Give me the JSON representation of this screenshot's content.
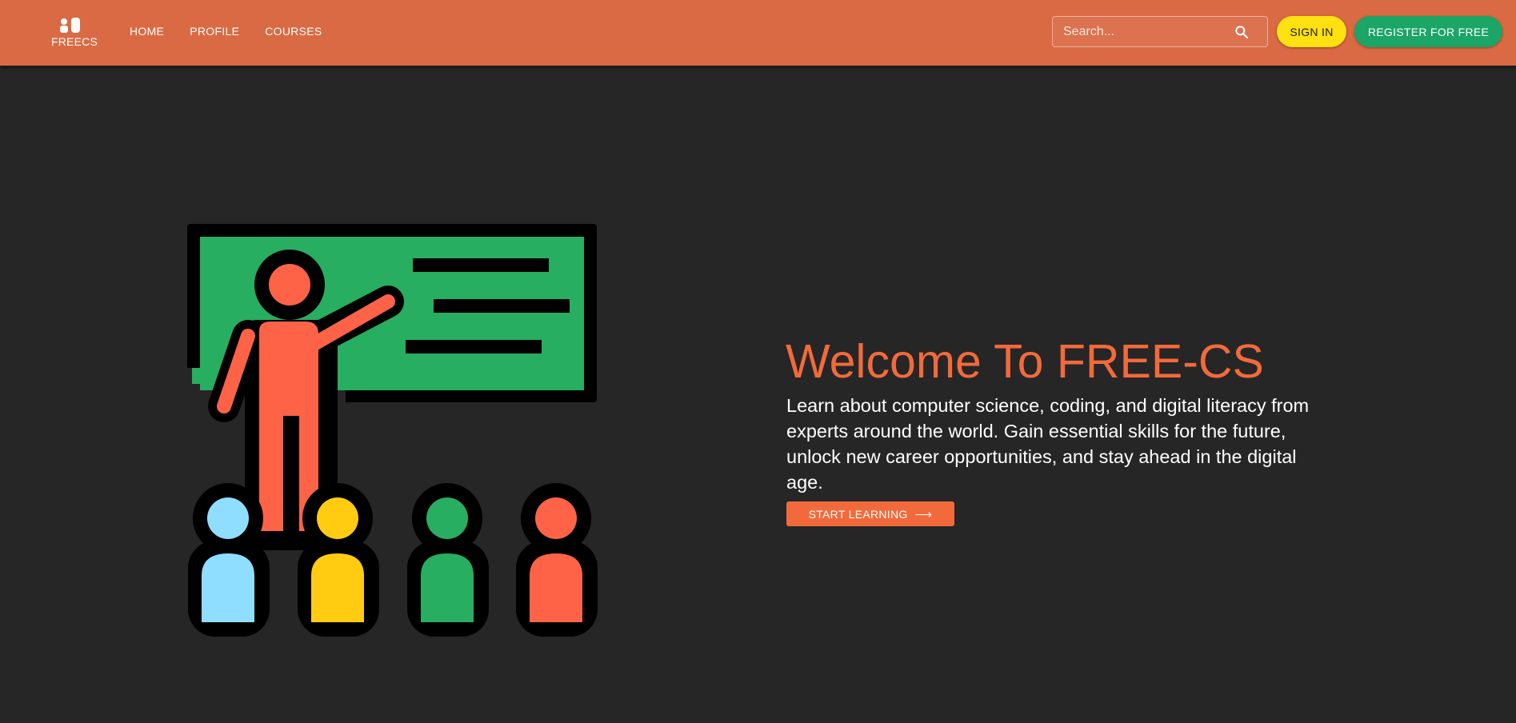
{
  "navbar": {
    "logo_text": "FREECS",
    "links": [
      {
        "label": "HOME"
      },
      {
        "label": "PROFILE"
      },
      {
        "label": "COURSES"
      }
    ],
    "search": {
      "placeholder": "Search...",
      "value": ""
    },
    "signin_label": "SIGN IN",
    "register_label": "REGISTER FOR FREE"
  },
  "hero": {
    "title": "Welcome To FREE-CS",
    "description": "Learn about computer science, coding, and digital literacy from experts around the world. Gain essential skills for the future, unlock new career opportunities, and stay ahead in the digital age.",
    "cta_label": "START LEARNING",
    "cta_icon": "arrow-right-icon",
    "illustration": "teacher-at-chalkboard-with-students"
  },
  "colors": {
    "navbar_bg": "#DA6A44",
    "page_bg": "#262626",
    "accent_orange": "#F26A3B",
    "signin_yellow": "#FFE010",
    "register_green": "#1BA566",
    "board_green": "#27AE60",
    "figure_red": "#FF6347",
    "student_blue": "#8FDDFF",
    "student_yellow": "#FFCC11"
  }
}
